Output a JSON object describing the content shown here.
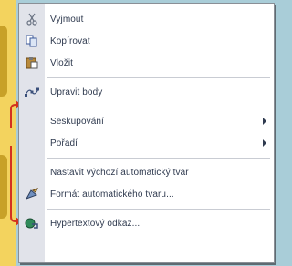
{
  "menu": {
    "items": [
      {
        "label": "Vyjmout",
        "icon": "scissors-icon",
        "disabled": false
      },
      {
        "label": "Kopírovat",
        "icon": "copy-icon",
        "disabled": false
      },
      {
        "label": "Vložit",
        "icon": "paste-icon",
        "disabled": false
      },
      {
        "label": "Upravit body",
        "icon": "edit-points-icon",
        "disabled": false
      },
      {
        "label": "Seskupování",
        "icon": "",
        "disabled": false,
        "submenu": true
      },
      {
        "label": "Pořadí",
        "icon": "",
        "disabled": false,
        "submenu": true
      },
      {
        "label": "Nastavit výchozí automatický tvar",
        "icon": "",
        "disabled": false
      },
      {
        "label": "Formát automatického tvaru...",
        "icon": "format-shape-icon",
        "disabled": false
      },
      {
        "label": "Hypertextový odkaz...",
        "icon": "hyperlink-icon",
        "disabled": false
      }
    ]
  },
  "colors": {
    "background": "#a9cdd8",
    "menu_bg": "#ffffff",
    "menu_strip": "#e1e3ea",
    "pointer": "#d2311f"
  }
}
